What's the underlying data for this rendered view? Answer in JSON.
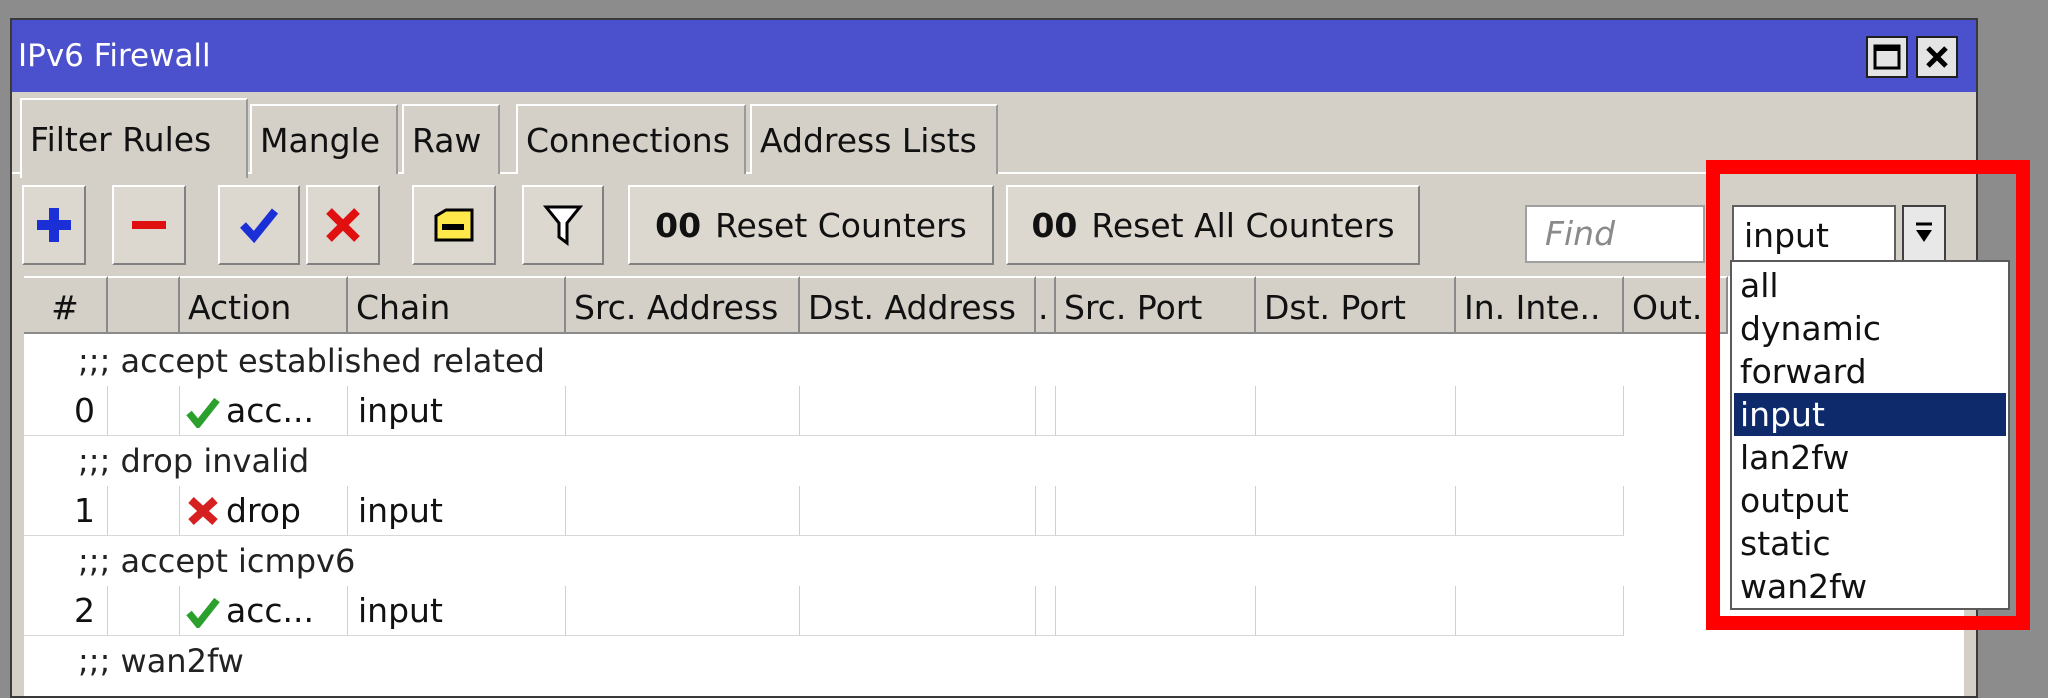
{
  "window": {
    "title": "IPv6 Firewall"
  },
  "tabs": [
    "Filter Rules",
    "Mangle",
    "Raw",
    "Connections",
    "Address Lists"
  ],
  "toolbar": {
    "reset_counters_icon": "00",
    "reset_counters": "Reset Counters",
    "reset_all_counters_icon": "00",
    "reset_all_counters": "Reset All Counters",
    "find_placeholder": "Find",
    "chain_filter_value": "input"
  },
  "columns": [
    "#",
    "",
    "Action",
    "Chain",
    "Src. Address",
    "Dst. Address",
    ".",
    "Src. Port",
    "Dst. Port",
    "In. Inte..",
    "Out. I"
  ],
  "rows": [
    {
      "type": "comment",
      "text": ";;; accept established related"
    },
    {
      "type": "rule",
      "num": "0",
      "action_icon": "check-icon",
      "action": "acc...",
      "chain": "input"
    },
    {
      "type": "comment",
      "text": ";;; drop invalid"
    },
    {
      "type": "rule",
      "num": "1",
      "action_icon": "x-icon",
      "action": "drop",
      "chain": "input"
    },
    {
      "type": "comment",
      "text": ";;; accept icmpv6"
    },
    {
      "type": "rule",
      "num": "2",
      "action_icon": "check-icon",
      "action": "acc...",
      "chain": "input"
    },
    {
      "type": "comment",
      "text": ";;; wan2fw"
    }
  ],
  "dropdown": {
    "options": [
      "all",
      "dynamic",
      "forward",
      "input",
      "lan2fw",
      "output",
      "static",
      "wan2fw"
    ],
    "selected": "input"
  },
  "colors": {
    "titlebar": "#4b50cd",
    "highlight_box": "#ff0000",
    "selected_option": "#0e2a6b",
    "accept_icon": "#2ca02c",
    "drop_icon": "#d62020"
  }
}
